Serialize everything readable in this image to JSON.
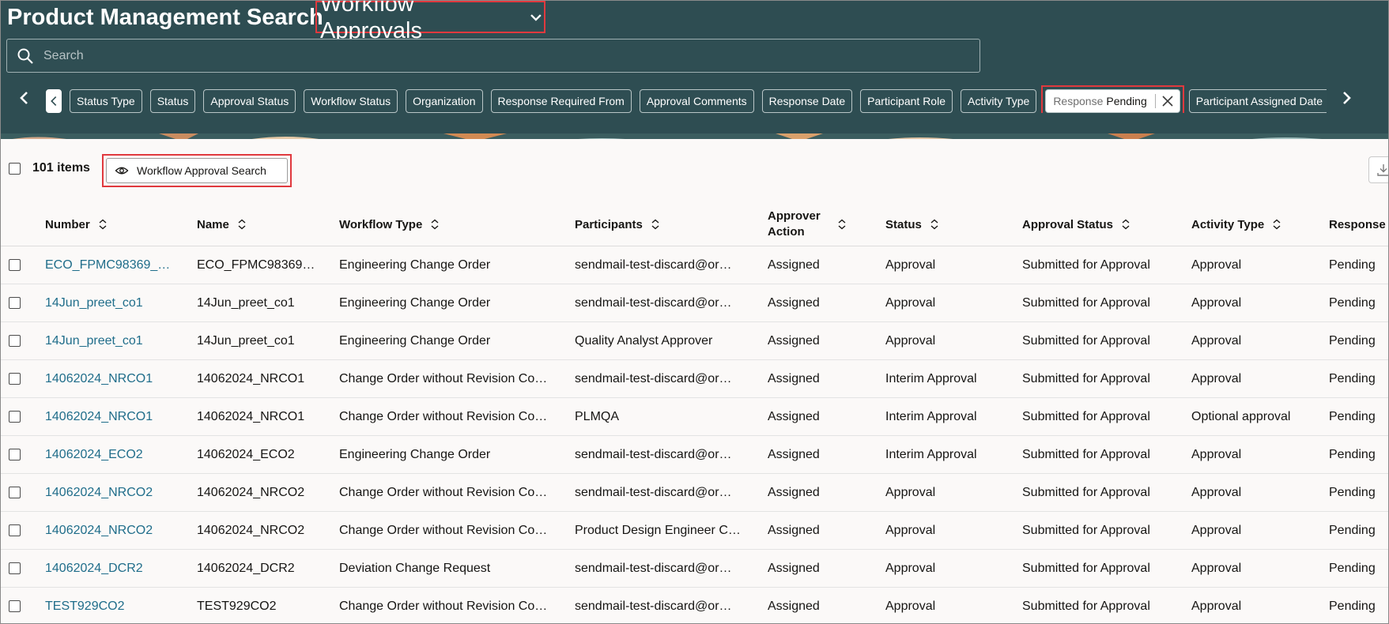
{
  "header": {
    "title": "Product Management Search",
    "view_selector": "Workflow Approvals"
  },
  "search": {
    "placeholder": "Search"
  },
  "filters": {
    "chips": [
      "Status Type",
      "Status",
      "Approval Status",
      "Workflow Status",
      "Organization",
      "Response Required From",
      "Approval Comments",
      "Response Date",
      "Participant Role",
      "Activity Type"
    ],
    "active_chip": {
      "label": "Response",
      "value": "Pending"
    },
    "trailing_chips": [
      "Participant Assigned Date"
    ]
  },
  "toolbar": {
    "item_count": "101 items",
    "view_button": "Workflow Approval Search"
  },
  "table": {
    "columns": [
      "Number",
      "Name",
      "Workflow Type",
      "Participants",
      "Approver Action",
      "Status",
      "Approval Status",
      "Activity Type",
      "Response"
    ],
    "rows": [
      [
        "ECO_FPMC98369_…",
        "ECO_FPMC98369…",
        "Engineering Change Order",
        "sendmail-test-discard@or…",
        "Assigned",
        "Approval",
        "Submitted for Approval",
        "Approval",
        "Pending"
      ],
      [
        "14Jun_preet_co1",
        "14Jun_preet_co1",
        "Engineering Change Order",
        "sendmail-test-discard@or…",
        "Assigned",
        "Approval",
        "Submitted for Approval",
        "Approval",
        "Pending"
      ],
      [
        "14Jun_preet_co1",
        "14Jun_preet_co1",
        "Engineering Change Order",
        "Quality Analyst Approver",
        "Assigned",
        "Approval",
        "Submitted for Approval",
        "Approval",
        "Pending"
      ],
      [
        "14062024_NRCO1",
        "14062024_NRCO1",
        "Change Order without Revision Co…",
        "sendmail-test-discard@or…",
        "Assigned",
        "Interim Approval",
        "Submitted for Approval",
        "Approval",
        "Pending"
      ],
      [
        "14062024_NRCO1",
        "14062024_NRCO1",
        "Change Order without Revision Co…",
        "PLMQA",
        "Assigned",
        "Interim Approval",
        "Submitted for Approval",
        "Optional approval",
        "Pending"
      ],
      [
        "14062024_ECO2",
        "14062024_ECO2",
        "Engineering Change Order",
        "sendmail-test-discard@or…",
        "Assigned",
        "Interim Approval",
        "Submitted for Approval",
        "Approval",
        "Pending"
      ],
      [
        "14062024_NRCO2",
        "14062024_NRCO2",
        "Change Order without Revision Co…",
        "sendmail-test-discard@or…",
        "Assigned",
        "Approval",
        "Submitted for Approval",
        "Approval",
        "Pending"
      ],
      [
        "14062024_NRCO2",
        "14062024_NRCO2",
        "Change Order without Revision Co…",
        "Product Design Engineer C…",
        "Assigned",
        "Approval",
        "Submitted for Approval",
        "Approval",
        "Pending"
      ],
      [
        "14062024_DCR2",
        "14062024_DCR2",
        "Deviation Change Request",
        "sendmail-test-discard@or…",
        "Assigned",
        "Approval",
        "Submitted for Approval",
        "Approval",
        "Pending"
      ],
      [
        "TEST929CO2",
        "TEST929CO2",
        "Change Order without Revision Co…",
        "sendmail-test-discard@or…",
        "Assigned",
        "Approval",
        "Submitted for Approval",
        "Approval",
        "Pending"
      ]
    ]
  },
  "colors": {
    "header_bg": "#2e4d52",
    "highlight": "#e0393e",
    "link": "#1f6d8a"
  },
  "icons": {
    "view_chevron": "chevron-down-icon",
    "search": "search-icon",
    "prev": "chevron-left-icon",
    "next": "chevron-right-icon",
    "chip_close": "close-icon",
    "view_button": "eye-icon",
    "download": "download-icon",
    "sort": "sort-icon"
  }
}
